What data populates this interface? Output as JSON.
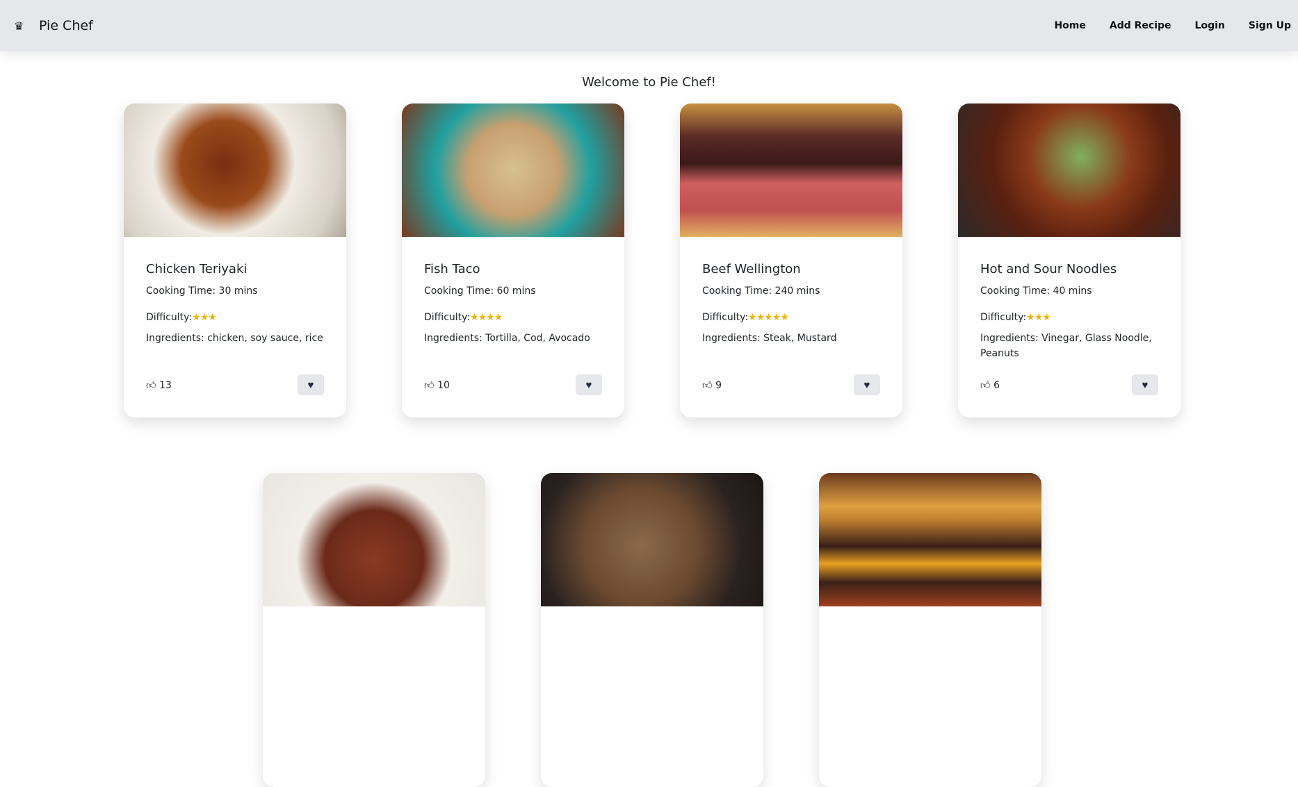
{
  "nav": {
    "brand": "Pie Chef",
    "links": [
      "Home",
      "Add Recipe",
      "Login",
      "Sign Up"
    ]
  },
  "welcome": "Welcome to Pie Chef!",
  "recipes": [
    {
      "title": "Chicken Teriyaki",
      "time": "Cooking Time: 30 mins",
      "difficulty_label": "Difficulty:",
      "stars": "★★★",
      "ingredients": "Ingredients: chicken, soy sauce, rice",
      "likes": "13"
    },
    {
      "title": "Fish Taco",
      "time": "Cooking Time: 60 mins",
      "difficulty_label": "Difficulty:",
      "stars": "★★★★",
      "ingredients": "Ingredients: Tortilla, Cod, Avocado",
      "likes": "10"
    },
    {
      "title": "Beef Wellington",
      "time": "Cooking Time: 240 mins",
      "difficulty_label": "Difficulty:",
      "stars": "★★★★★",
      "ingredients": "Ingredients: Steak, Mustard",
      "likes": "9"
    },
    {
      "title": "Hot and Sour Noodles",
      "time": "Cooking Time: 40 mins",
      "difficulty_label": "Difficulty:",
      "stars": "★★★",
      "ingredients": "Ingredients: Vinegar, Glass Noodle, Peanuts",
      "likes": "6"
    }
  ],
  "colors": {
    "nav_bg": "#e5e7eb",
    "star": "#f0b400"
  }
}
